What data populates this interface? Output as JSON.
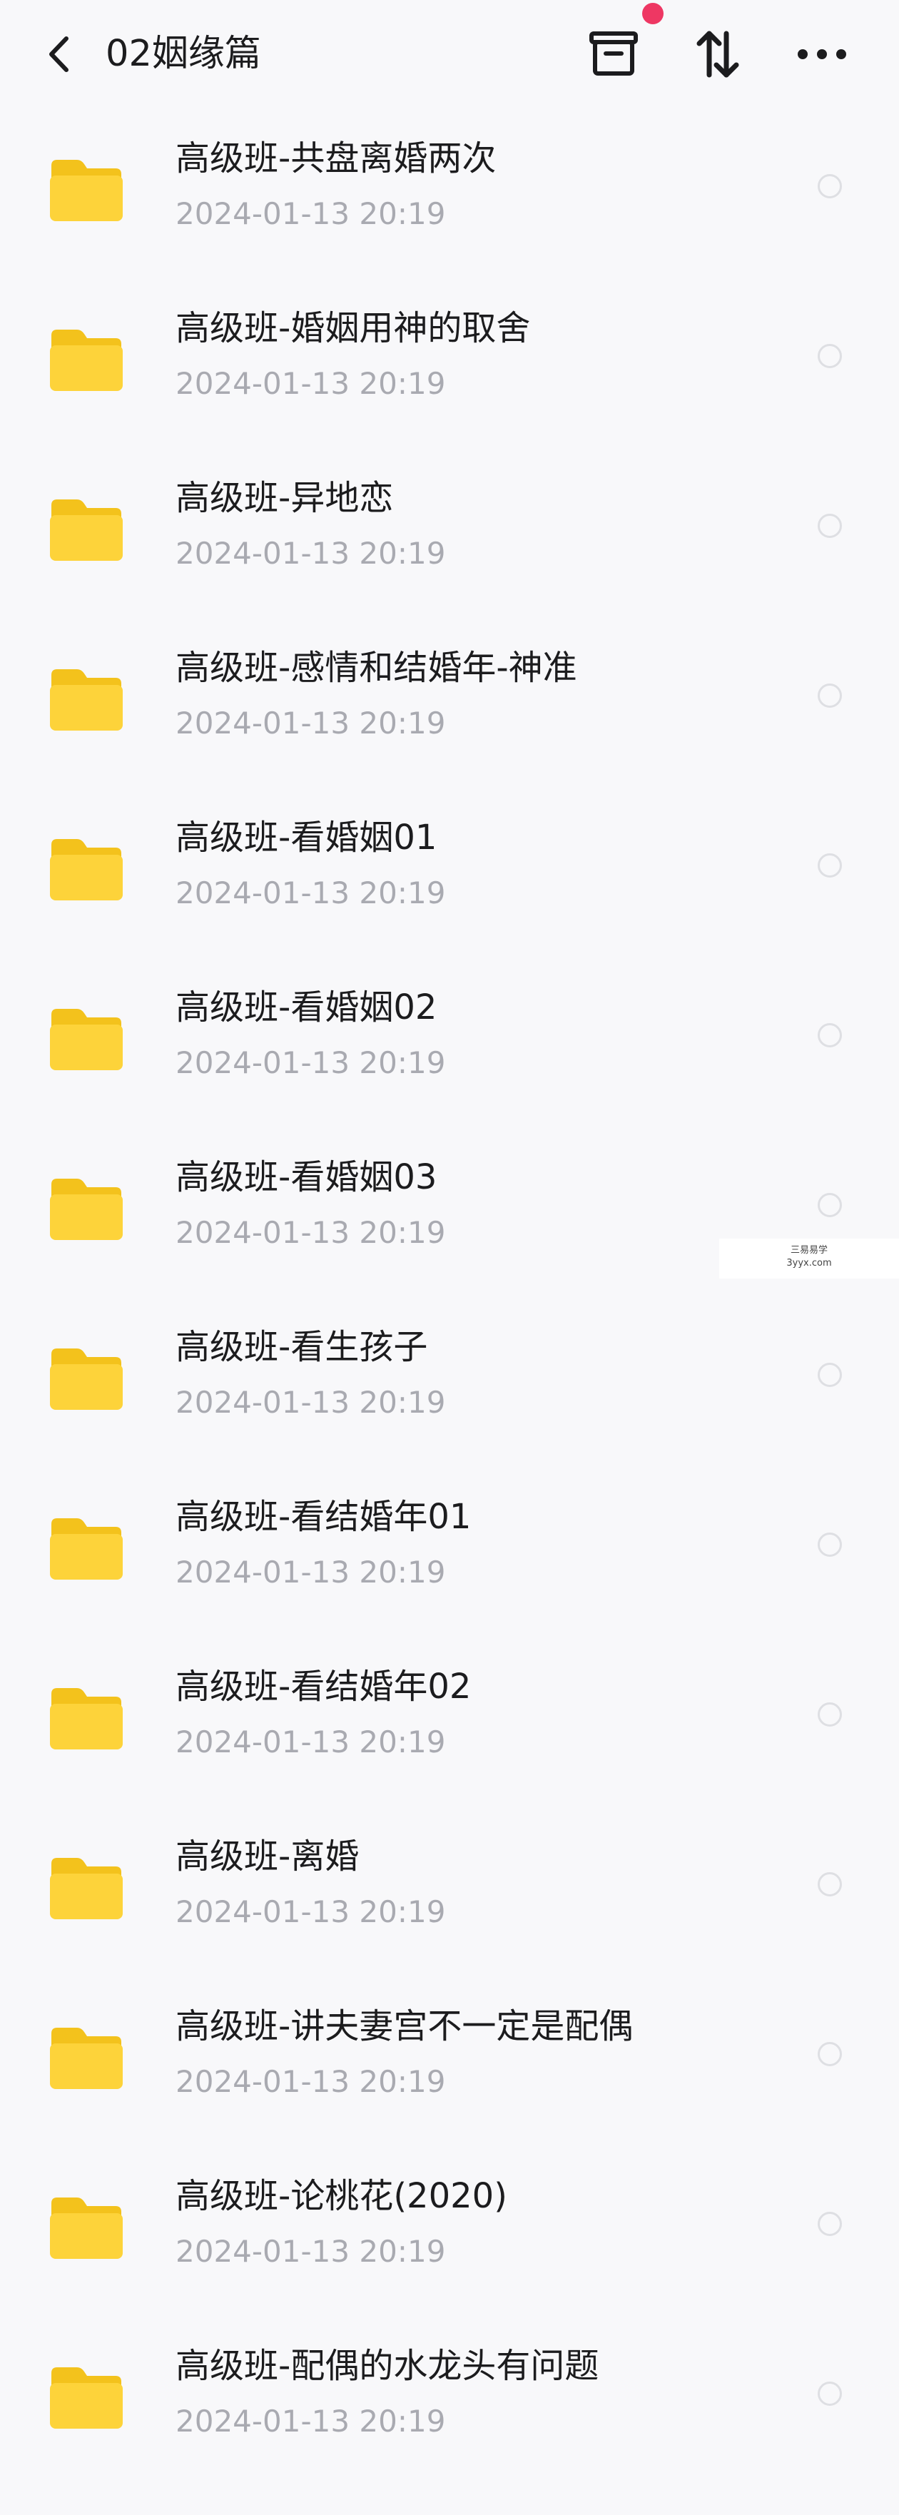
{
  "header": {
    "title": "02姻缘篇",
    "back_icon": "chevron-left-icon",
    "archive_icon": "archive-box-icon",
    "sort_icon": "sort-arrows-icon",
    "more_icon": "more-dots-icon",
    "badge_color": "#ee3763"
  },
  "items": [
    {
      "name": "高级班-共盘离婚两次",
      "date": "2024-01-13  20:19"
    },
    {
      "name": "高级班-婚姻用神的取舍",
      "date": "2024-01-13  20:19"
    },
    {
      "name": "高级班-异地恋",
      "date": "2024-01-13  20:19"
    },
    {
      "name": "高级班-感情和结婚年-神准",
      "date": "2024-01-13  20:19"
    },
    {
      "name": "高级班-看婚姻01",
      "date": "2024-01-13  20:19"
    },
    {
      "name": "高级班-看婚姻02",
      "date": "2024-01-13  20:19"
    },
    {
      "name": "高级班-看婚姻03",
      "date": "2024-01-13  20:19"
    },
    {
      "name": "高级班-看生孩子",
      "date": "2024-01-13  20:19"
    },
    {
      "name": "高级班-看结婚年01",
      "date": "2024-01-13  20:19"
    },
    {
      "name": "高级班-看结婚年02",
      "date": "2024-01-13  20:19"
    },
    {
      "name": "高级班-离婚",
      "date": "2024-01-13  20:19"
    },
    {
      "name": "高级班-讲夫妻宫不一定是配偶",
      "date": "2024-01-13  20:19"
    },
    {
      "name": "高级班-论桃花(2020)",
      "date": "2024-01-13  20:19"
    },
    {
      "name": "高级班-配偶的水龙头有问题",
      "date": "2024-01-13  20:19"
    }
  ],
  "watermark": {
    "line1": "三易易学",
    "line2": "3yyx.com"
  },
  "colors": {
    "folder": "#fdd33a",
    "folder_back": "#f3c21c"
  }
}
